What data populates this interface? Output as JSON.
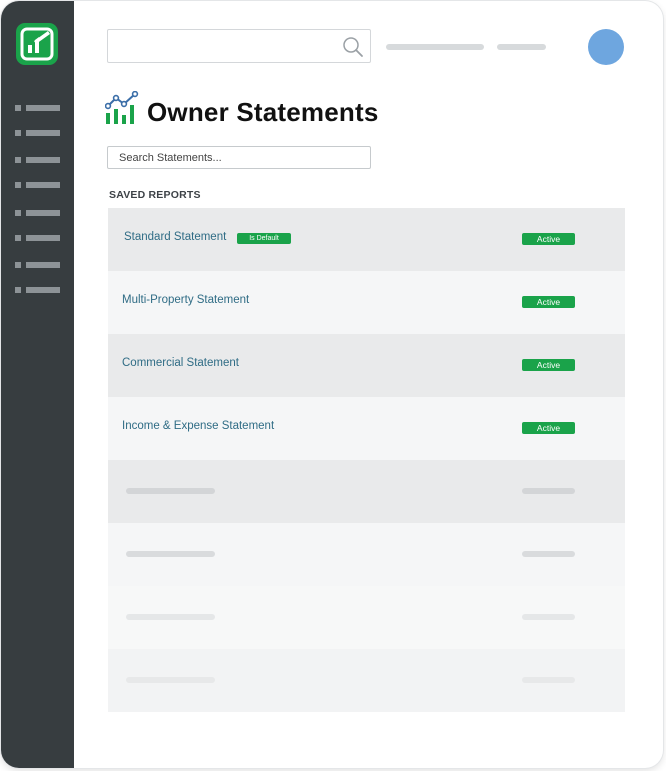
{
  "app": {
    "title": "Owner Statements",
    "logo_icon": "brand-logo-icon",
    "title_icon": "analytics-chart-icon",
    "brand_color": "#1aa34a",
    "sidebar_color": "#373d40"
  },
  "header": {
    "search_icon": "search-icon",
    "avatar_color": "#6ea6df"
  },
  "search": {
    "placeholder": "Search Statements..."
  },
  "saved_reports": {
    "title": "SAVED REPORTS",
    "rows": [
      {
        "name": "Standard Statement",
        "badge": "Is Default",
        "status": "Active"
      },
      {
        "name": "Multi-Property Statement",
        "status": "Active"
      },
      {
        "name": "Commercial Statement",
        "status": "Active"
      },
      {
        "name": "Income & Expense Statement",
        "status": "Active"
      }
    ]
  }
}
